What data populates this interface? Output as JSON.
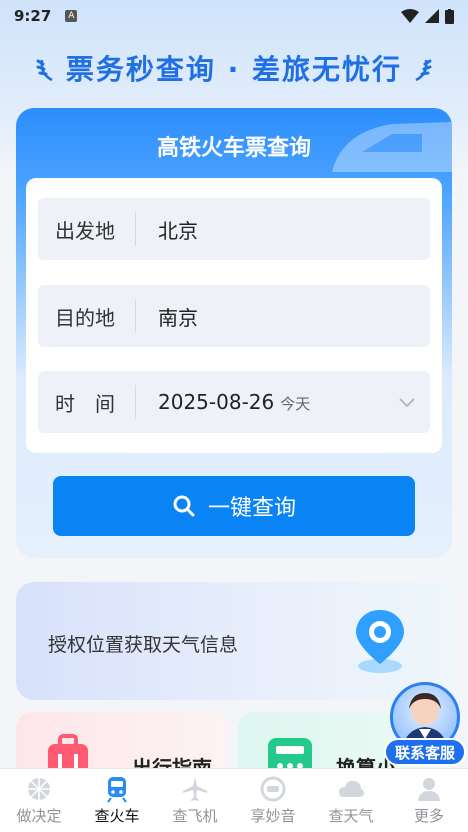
{
  "status_bar": {
    "time": "9:27",
    "badge": "A"
  },
  "slogan": "票务秒查询 · 差旅无忧行",
  "query_card": {
    "title": "高铁火车票查询",
    "rows": [
      {
        "label": "出发地",
        "value": "北京"
      },
      {
        "label": "目的地",
        "value": "南京"
      },
      {
        "label": "时　间",
        "value": "2025-08-26",
        "sub": "今天"
      }
    ],
    "search_label": "一键查询"
  },
  "weather_card": {
    "text": "授权位置获取天气信息"
  },
  "mini_cards": [
    {
      "label": "出行指南",
      "icon": "luggage-icon"
    },
    {
      "label": "换算小",
      "icon": "calculator-icon"
    }
  ],
  "support": {
    "label": "联系客服"
  },
  "bottom_nav": [
    {
      "label": "做决定",
      "icon": "decide-icon"
    },
    {
      "label": "查火车",
      "icon": "train-icon",
      "active": true
    },
    {
      "label": "查飞机",
      "icon": "plane-icon"
    },
    {
      "label": "享妙音",
      "icon": "music-icon"
    },
    {
      "label": "查天气",
      "icon": "cloud-icon"
    },
    {
      "label": "更多",
      "icon": "user-icon"
    }
  ],
  "colors": {
    "accent": "#0a84f5",
    "slogan": "#1f6fe5",
    "nav_inactive": "#8e949c"
  }
}
